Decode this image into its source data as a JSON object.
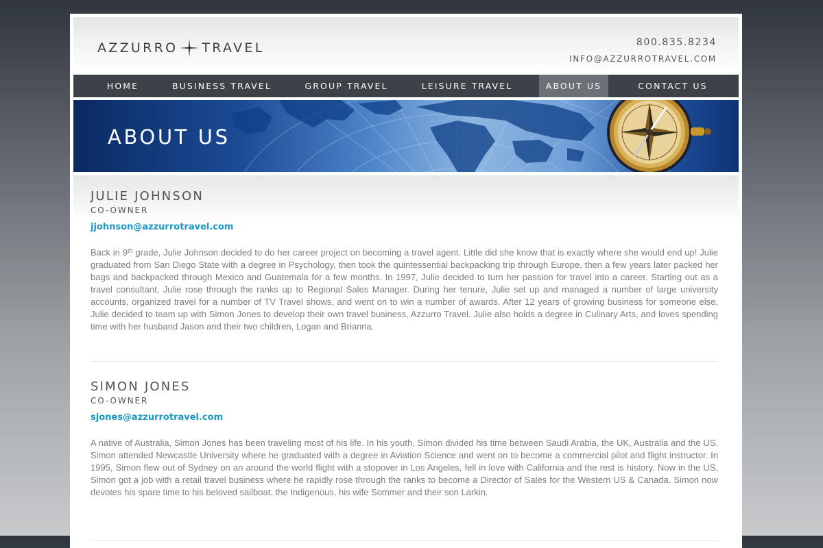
{
  "site": {
    "logo_left": "AZZURRO",
    "logo_right": "TRAVEL",
    "phone": "800.835.8234",
    "email": "INFO@AZZURROTRAVEL.COM"
  },
  "nav": {
    "items": [
      {
        "label": "HOME",
        "active": false
      },
      {
        "label": "BUSINESS TRAVEL",
        "active": false
      },
      {
        "label": "GROUP TRAVEL",
        "active": false
      },
      {
        "label": "LEISURE TRAVEL",
        "active": false
      },
      {
        "label": "ABOUT US",
        "active": true
      },
      {
        "label": "CONTACT US",
        "active": false
      }
    ]
  },
  "banner": {
    "title": "ABOUT US"
  },
  "profiles": [
    {
      "name": "JULIE JOHNSON",
      "role": "CO-OWNER",
      "email": "jjohnson@azzurrotravel.com",
      "bio_pre": "Back in 9",
      "bio_sup": "th",
      "bio": " grade, Julie Johnson decided to do her career project on becoming a travel agent. Little did she know that is exactly where she would end up! Julie graduated from San Diego State with a degree in Psychology, then took the quintessential backpacking trip through Europe, then a few years later packed her bags and backpacked through Mexico and Guatemala for a few months. In 1997, Julie decided to turn her passion for travel into a career. Starting out as a travel consultant, Julie rose through the ranks up to Regional Sales Manager. During her tenure, Julie set up and managed a number of large university accounts, organized travel for a number of TV Travel shows, and went on to win a number of awards. After 12 years of growing business for someone else, Julie decided to team up with Simon Jones to develop their own travel business, Azzurro Travel. Julie also holds a degree in Culinary Arts, and loves spending time with her husband Jason and their two children, Logan and Brianna."
    },
    {
      "name": "SIMON JONES",
      "role": "CO-OWNER",
      "email": "sjones@azzurrotravel.com",
      "bio": "A native of Australia, Simon Jones has been traveling most of his life. In his youth, Simon divided his time between Saudi Arabia, the UK, Australia and the US. Simon attended Newcastle University where he graduated with a degree in Aviation Science and went on to become a commercial pilot and flight instructor. In 1995, Simon flew out of Sydney on an around the world flight with a stopover in Los Angeles, fell in love with California and the rest is history. Now in the US, Simon got a job with a retail travel business where he rapidly rose through the ranks to become a Director of Sales for the Western US & Canada. Simon now devotes his spare time to his beloved sailboat, the Indigenous, his wife Sommer and their son Larkin."
    }
  ],
  "icons": {
    "logo_mark": "compass-star-icon",
    "banner_art": "world-map-compass-icon"
  },
  "colors": {
    "nav_bg": "#3c4248",
    "nav_active": "#6b7176",
    "link": "#1c97c7",
    "body_text": "#7a7e81",
    "heading": "#4f5356"
  }
}
